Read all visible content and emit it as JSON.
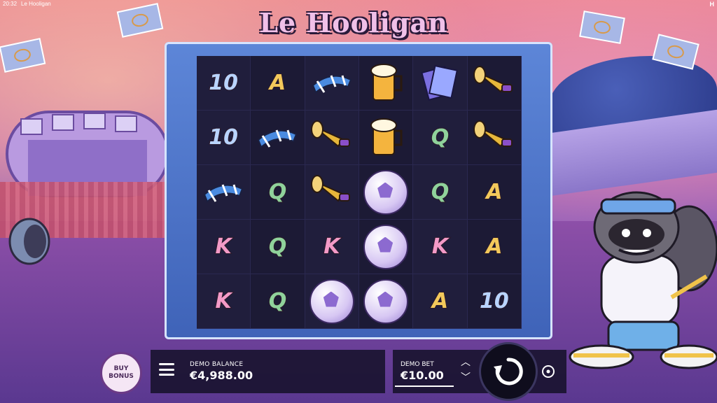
{
  "status_bar": {
    "time": "20:32",
    "app_name": "Le Hooligan",
    "brand": "H"
  },
  "game": {
    "title": "Le Hooligan"
  },
  "reels": [
    [
      "10",
      "A",
      "scarf",
      "beer",
      "tickets",
      "horn"
    ],
    [
      "10",
      "scarf",
      "horn",
      "beer",
      "Q",
      "horn"
    ],
    [
      "scarf",
      "Q",
      "horn",
      "ball",
      "Q",
      "A"
    ],
    [
      "K",
      "Q",
      "K",
      "ball",
      "K",
      "A"
    ],
    [
      "K",
      "Q",
      "ball",
      "ball",
      "A",
      "10"
    ]
  ],
  "controls": {
    "buy_bonus_label": "BUY BONUS",
    "balance_label": "DEMO BALANCE",
    "balance_value": "€4,988.00",
    "bet_label": "DEMO BET",
    "bet_value": "€10.00"
  },
  "colors": {
    "frame": "#4a70c7",
    "panel": "#14102a",
    "accent": "#f0c0e8"
  }
}
